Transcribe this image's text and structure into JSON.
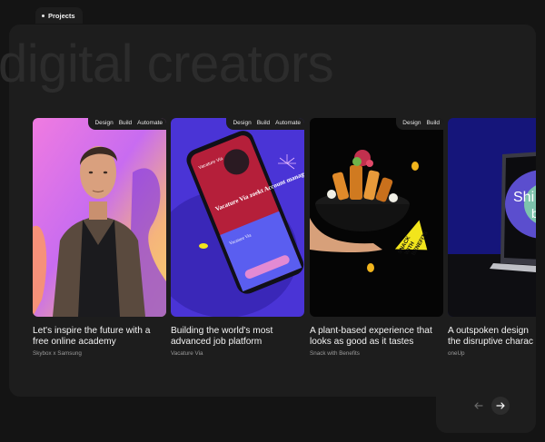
{
  "tab": {
    "label": "Projects"
  },
  "hero": {
    "text": "digital creators"
  },
  "cards": [
    {
      "title_line1": "Let's inspire the future with a",
      "title_line2": "free online academy",
      "client": "Skybox x Samsung",
      "tags": [
        "Design",
        "Build",
        "Automate"
      ]
    },
    {
      "title_line1": "Building the world's most",
      "title_line2": "advanced job platform",
      "client": "Vacature Via",
      "tags": [
        "Design",
        "Build",
        "Automate"
      ]
    },
    {
      "title_line1": "A plant-based experience that",
      "title_line2": "looks as good as it tastes",
      "client": "Snack with Benefits",
      "tags": [
        "Design",
        "Build"
      ]
    },
    {
      "title_line1": "A outspoken design",
      "title_line2": "the disruptive charac",
      "client": "oneUp",
      "tags": []
    }
  ],
  "card2_screen": {
    "brand": "Vacature Via",
    "headline": "Vacature Via zoekt Account manager",
    "section": "Vacature Via"
  },
  "card3_label": {
    "line1": "SNACK",
    "line2": "WITH",
    "line3": "BENEFITS"
  },
  "card4_screen": {
    "line1": "Shi",
    "line2": "bi"
  },
  "icons": {
    "prev": "arrow-left-icon",
    "next": "arrow-right-icon",
    "tab_dot": "dot-icon"
  },
  "colors": {
    "background": "#141414",
    "panel": "#1d1d1d",
    "accent_purple": "#4b33d4",
    "accent_yellow": "#f2e51c"
  }
}
